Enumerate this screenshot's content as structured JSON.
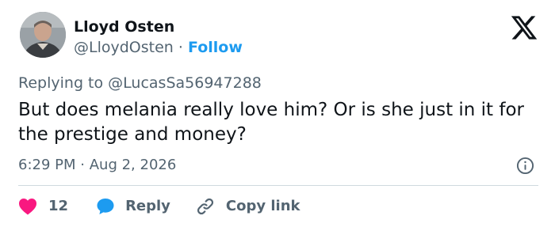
{
  "author": {
    "name": "Lloyd Osten",
    "handle": "@LloydOsten",
    "separator": "·",
    "follow_label": "Follow"
  },
  "reply_context": {
    "prefix": "Replying to",
    "mention": "@LucasSa56947288"
  },
  "tweet": {
    "text": "But does melania really love him? Or is she just in it for the prestige and money?",
    "time": "6:29 PM",
    "separator": "·",
    "date": "Aug 2, 2026"
  },
  "actions": {
    "like_count": "12",
    "reply_label": "Reply",
    "copy_link_label": "Copy link"
  },
  "icons": {
    "brand": "x-logo-icon",
    "info": "info-icon",
    "like": "heart-icon",
    "reply": "reply-bubble-icon",
    "copy": "link-icon"
  },
  "colors": {
    "text_primary": "#0f1419",
    "text_secondary": "#536471",
    "accent": "#1d9bf0",
    "like": "#f91880",
    "divider": "#cfd9de"
  }
}
